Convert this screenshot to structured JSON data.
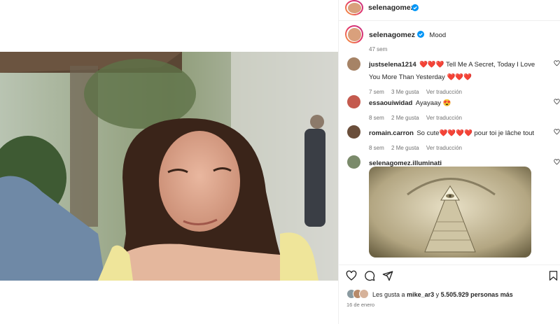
{
  "header": {
    "username": "selenagomez"
  },
  "caption": {
    "username": "selenagomez",
    "text": "Mood",
    "time": "47 sem"
  },
  "comments": [
    {
      "username": "justselena1214",
      "text": "❤️❤️❤️ Tell Me A Secret, Today I Love You More Than Yesterday ❤️❤️❤️",
      "time": "7 sem",
      "likes": "3 Me gusta",
      "translate": "Ver traducción"
    },
    {
      "username": "essaouiwidad",
      "text": "Ayayaay 😍",
      "time": "8 sem",
      "likes": "2 Me gusta",
      "translate": "Ver traducción"
    },
    {
      "username": "romain.carron",
      "text": "So cute❤️❤️❤️❤️ pour toi je lâche tout",
      "time": "8 sem",
      "likes": "2 Me gusta",
      "translate": "Ver traducción"
    },
    {
      "username": "selenagomez.illuminati",
      "text": ""
    }
  ],
  "likes_bar": {
    "prefix": "Les gusta a",
    "user": "mike_ar3",
    "and": "y",
    "count": "5.505.929 personas más"
  },
  "date": "16 de enero",
  "icons": [
    "heart-icon",
    "comment-icon",
    "share-icon",
    "bookmark-icon",
    "verified-badge-icon"
  ],
  "colors": {
    "verified": "#0095f6",
    "muted": "#737373",
    "text": "#262626",
    "heart": "#ed4956"
  }
}
